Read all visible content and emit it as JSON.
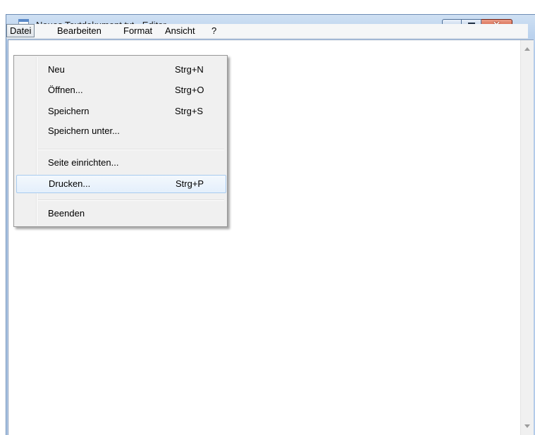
{
  "window": {
    "title": "Neues Textdokument.txt - Editor",
    "close_glyph": "✕"
  },
  "menubar": {
    "items": [
      "Datei",
      "Bearbeiten",
      "Format",
      "Ansicht",
      "?"
    ],
    "active": "Datei"
  },
  "file_menu": {
    "items": [
      {
        "label": "Neu",
        "shortcut": "Strg+N"
      },
      {
        "label": "Öffnen...",
        "shortcut": "Strg+O"
      },
      {
        "label": "Speichern",
        "shortcut": "Strg+S"
      },
      {
        "label": "Speichern unter...",
        "shortcut": ""
      },
      {
        "label": "Seite einrichten...",
        "shortcut": ""
      },
      {
        "label": "Drucken...",
        "shortcut": "Strg+P"
      },
      {
        "label": "Beenden",
        "shortcut": ""
      }
    ],
    "highlighted": "Drucken..."
  },
  "editor": {
    "content": ""
  },
  "icons": {
    "app": "notepad-icon",
    "minimize": "minimize-icon",
    "maximize": "maximize-icon",
    "close": "close-icon",
    "scroll_up": "scroll-up-arrow-icon",
    "scroll_down": "scroll-down-arrow-icon"
  },
  "colors": {
    "title_bar": "#bcd3ee",
    "close_button": "#c53d1f",
    "menu_highlight": "#a8cbef",
    "menu_background": "#f0f0f0"
  }
}
